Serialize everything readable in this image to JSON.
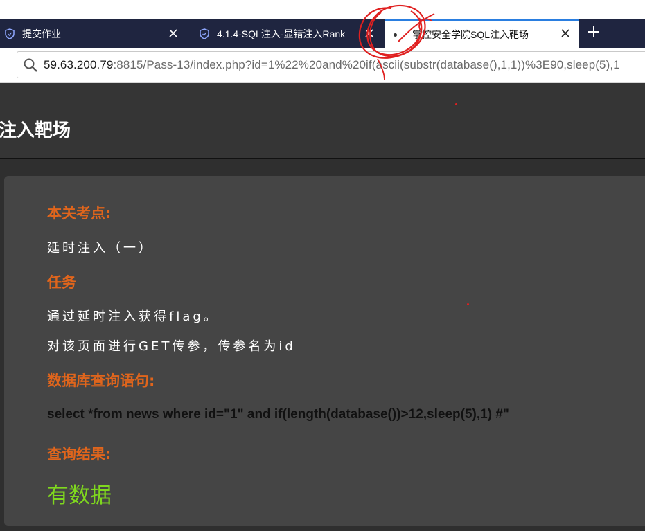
{
  "browser": {
    "tabs": [
      {
        "label": "提交作业",
        "icon": "shield-icon"
      },
      {
        "label": "4.1.4-SQL注入-显错注入Rank",
        "icon": "shield-icon"
      },
      {
        "label": "掌控安全学院SQL注入靶场",
        "active": true
      }
    ],
    "address": {
      "host": "59.63.200.79",
      "rest": ":8815/Pass-13/index.php?id=1%22%20and%20if(ascii(substr(database(),1,1))%3E90,sleep(5),1"
    }
  },
  "page": {
    "title": "注入靶场",
    "sections": {
      "test_point_heading": "本关考点:",
      "test_point_text": "延时注入（一）",
      "task_heading": "任务",
      "task_line1": "通过延时注入获得flag。",
      "task_line2": "对该页面进行GET传参，传参名为id",
      "query_heading": "数据库查询语句:",
      "query_text": "select *from news where id=\"1\" and if(length(database())>12,sleep(5),1) #\"",
      "result_heading": "查询结果:",
      "result_text": "有数据"
    }
  },
  "colors": {
    "tabbar_bg": "#1f2540",
    "active_tab_accent": "#2a7ee0",
    "heading_orange": "#e0651c",
    "result_green": "#7fd81e",
    "panel_bg": "#454545",
    "page_bg": "#2f2f2f",
    "scribble_red": "#e02020"
  }
}
